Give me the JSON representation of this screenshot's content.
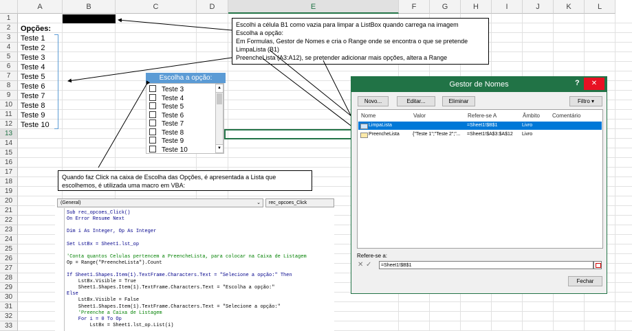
{
  "sheet": {
    "columns": [
      "A",
      "B",
      "C",
      "D",
      "E",
      "F",
      "G",
      "H",
      "I",
      "J",
      "K",
      "L"
    ],
    "rows": [
      "1",
      "2",
      "3",
      "4",
      "5",
      "6",
      "7",
      "8",
      "9",
      "10",
      "11",
      "12",
      "13",
      "14",
      "15",
      "16",
      "17",
      "18",
      "19",
      "20",
      "21",
      "22",
      "23",
      "24",
      "25",
      "26",
      "27",
      "28",
      "29",
      "30",
      "31",
      "32",
      "33"
    ],
    "a2": "Opções:",
    "a_items": [
      "Teste 1",
      "Teste 2",
      "Teste 3",
      "Teste 4",
      "Teste 5",
      "Teste 6",
      "Teste 7",
      "Teste 8",
      "Teste 9",
      "Teste 10"
    ]
  },
  "callout_top": {
    "lines": [
      "Escolhi a célula B1 como vazia para limpar a ListBox quando carrega na imagem",
      "Escolha a opção:",
      "Em Formulas, Gestor de Nomes e cria o Range onde se encontra o que se pretende",
      "LimpaLista (B1)",
      "PreencheLista (A3:A12), se pretender adicionar mais opções, altera a Range"
    ]
  },
  "callout_bottom": {
    "lines": [
      "Quando faz Click na caixa de Escolha das Opções, é apresentada a Lista que",
      "escolhemos, é utilizada uma macro em VBA:"
    ]
  },
  "listbox": {
    "header": "Escolha a opção:",
    "items": [
      "Teste 3",
      "Teste 4",
      "Teste 5",
      "Teste 6",
      "Teste 7",
      "Teste 8",
      "Teste 9",
      "Teste 10"
    ]
  },
  "vba": {
    "object_dropdown": "(General)",
    "proc_dropdown": "rec_opcoes_Click",
    "lines": [
      {
        "t": "Sub rec_opcoes_Click()",
        "c": "kw"
      },
      {
        "t": "On Error Resume Next",
        "c": "kw"
      },
      {
        "t": "",
        "c": ""
      },
      {
        "t": "Dim i As Integer, Op As Integer",
        "c": "kw"
      },
      {
        "t": "",
        "c": ""
      },
      {
        "t": "Set LstBx = Sheet1.lst_op",
        "c": "kw"
      },
      {
        "t": "",
        "c": ""
      },
      {
        "t": "'Conta quantos Celulas pertencem a PreencheLista, para colocar na Caixa de Listagem",
        "c": "cm"
      },
      {
        "t": "Op = Range(\"PreencheLista\").Count",
        "c": ""
      },
      {
        "t": "",
        "c": ""
      },
      {
        "t": "If Sheet1.Shapes.Item(1).TextFrame.Characters.Text = \"Selecione a opção:\" Then",
        "c": "kw"
      },
      {
        "t": "    LstBx.Visible = True",
        "c": ""
      },
      {
        "t": "    Sheet1.Shapes.Item(1).TextFrame.Characters.Text = \"Escolha a opção:\"",
        "c": ""
      },
      {
        "t": "Else",
        "c": "kw"
      },
      {
        "t": "    LstBx.Visible = False",
        "c": ""
      },
      {
        "t": "    Sheet1.Shapes.Item(1).TextFrame.Characters.Text = \"Selecione a opção:\"",
        "c": ""
      },
      {
        "t": "    'Preenche a Caixa de Listagem",
        "c": "cm"
      },
      {
        "t": "    For i = 0 To Op",
        "c": "kw"
      },
      {
        "t": "        LstBx = Sheet1.lst_op.List(i)",
        "c": ""
      }
    ]
  },
  "dialog": {
    "title": "Gestor de Nomes",
    "help": "?",
    "close": "✕",
    "btn_new": "Novo...",
    "btn_edit": "Editar...",
    "btn_delete": "Eliminar",
    "btn_filter": "Filtro ▾",
    "col_name": "Nome",
    "col_value": "Valor",
    "col_refers": "Refere-se A",
    "col_scope": "Âmbito",
    "col_comment": "Comentário",
    "rows": [
      {
        "name": "LimpaLista",
        "value": "",
        "refers": "=Sheet1!$B$1",
        "scope": "Livro",
        "comment": ""
      },
      {
        "name": "PreencheLista",
        "value": "{\"Teste 1\";\"Teste 2\";\"...",
        "refers": "=Sheet1!$A$3:$A$12",
        "scope": "Livro",
        "comment": ""
      }
    ],
    "refers_label": "Refere-se a:",
    "refers_value": "=Sheet1!$B$1",
    "btn_close": "Fechar"
  }
}
